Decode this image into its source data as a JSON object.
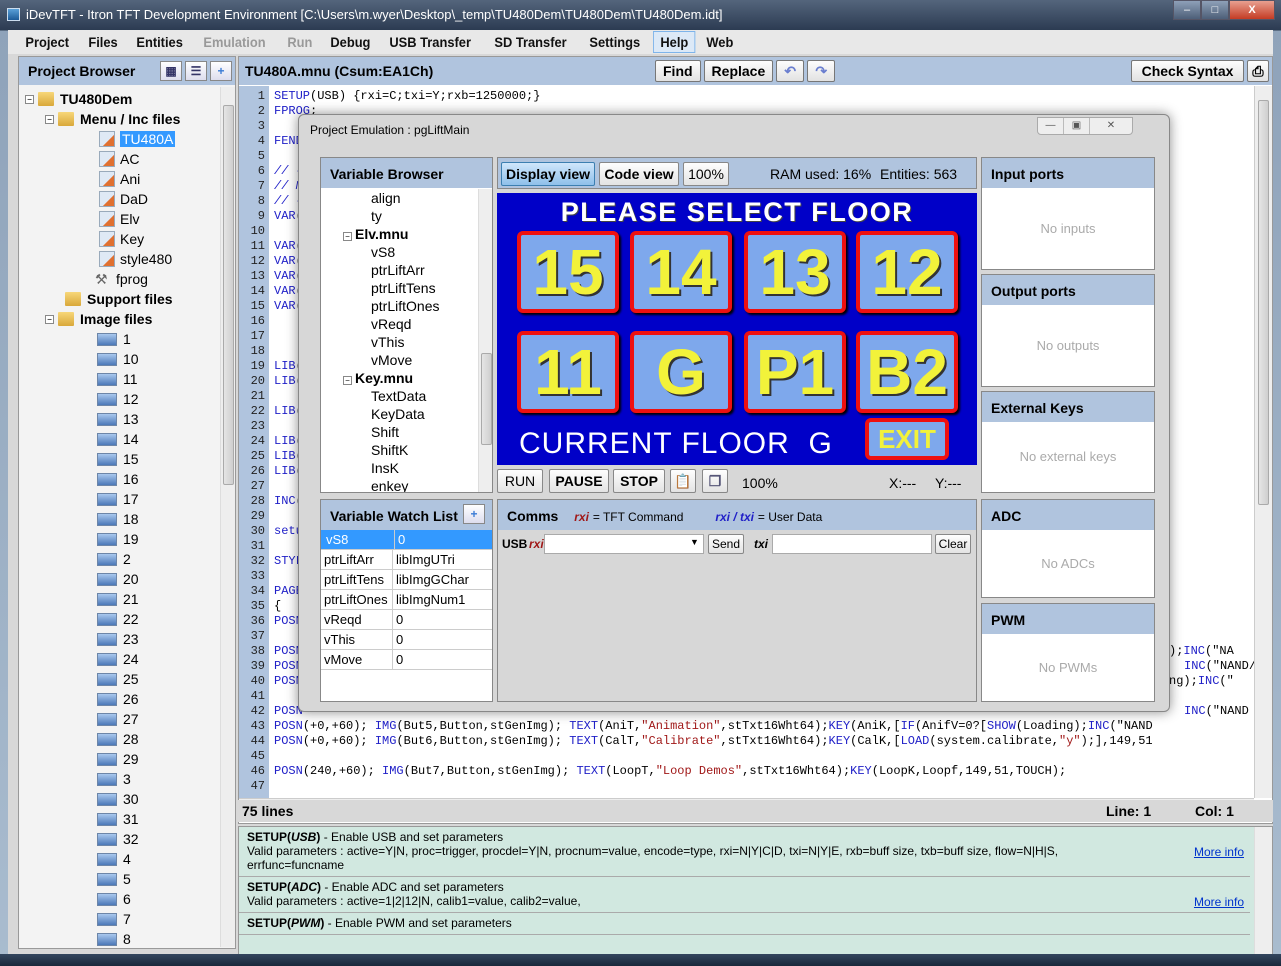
{
  "window": {
    "title": "iDevTFT - Itron TFT Development Environment  [C:\\Users\\m.wyer\\Desktop\\_temp\\TU480Dem\\TU480Dem\\TU480Dem.idt]",
    "minimize": "–",
    "maximize": "□",
    "close": "X"
  },
  "menu": [
    {
      "label": "Project",
      "state": "normal"
    },
    {
      "label": "Files",
      "state": "normal"
    },
    {
      "label": "Entities",
      "state": "normal"
    },
    {
      "label": "Emulation",
      "state": "disabled"
    },
    {
      "label": "Run",
      "state": "disabled"
    },
    {
      "label": "Debug",
      "state": "normal"
    },
    {
      "label": "USB Transfer",
      "state": "normal"
    },
    {
      "label": "SD Transfer",
      "state": "normal"
    },
    {
      "label": "Settings",
      "state": "normal"
    },
    {
      "label": "Help",
      "state": "active"
    },
    {
      "label": "Web",
      "state": "normal"
    }
  ],
  "project_browser": {
    "title": "Project Browser",
    "root": "TU480Dem",
    "menu_folder": "Menu / Inc files",
    "menu_files": [
      "TU480A",
      "AC",
      "Ani",
      "DaD",
      "Elv",
      "Key",
      "style480"
    ],
    "selected_file": "TU480A",
    "tool_file": "fprog",
    "support_folder": "Support files",
    "image_folder": "Image files",
    "image_files": [
      "1",
      "10",
      "11",
      "12",
      "13",
      "14",
      "15",
      "16",
      "17",
      "18",
      "19",
      "2",
      "20",
      "21",
      "22",
      "23",
      "24",
      "25",
      "26",
      "27",
      "28",
      "29",
      "3",
      "30",
      "31",
      "32",
      "4",
      "5",
      "6",
      "7",
      "8"
    ]
  },
  "editor": {
    "file_title": "TU480A.mnu  (Csum:EA1Ch)",
    "find_label": "Find",
    "replace_label": "Replace",
    "check_syntax_label": "Check Syntax",
    "lines": [
      {
        "n": "1",
        "t": "SETUP(USB) {rxi=C;txi=Y;rxb=1250000;}"
      },
      {
        "n": "2",
        "t": "FPROG;"
      },
      {
        "n": "3",
        "t": ""
      },
      {
        "n": "4",
        "t": "FEND"
      },
      {
        "n": "5",
        "t": ""
      },
      {
        "n": "6",
        "t": "// -"
      },
      {
        "n": "7",
        "t": "// M"
      },
      {
        "n": "8",
        "t": "// -"
      },
      {
        "n": "9",
        "t": "VAR("
      },
      {
        "n": "10",
        "t": ""
      },
      {
        "n": "11",
        "t": "VAR("
      },
      {
        "n": "12",
        "t": "VAR("
      },
      {
        "n": "13",
        "t": "VAR("
      },
      {
        "n": "14",
        "t": "VAR("
      },
      {
        "n": "15",
        "t": "VAR("
      },
      {
        "n": "16",
        "t": ""
      },
      {
        "n": "17",
        "t": ""
      },
      {
        "n": "18",
        "t": ""
      },
      {
        "n": "19",
        "t": "LIB("
      },
      {
        "n": "20",
        "t": "LIB("
      },
      {
        "n": "21",
        "t": ""
      },
      {
        "n": "22",
        "t": "LIB("
      },
      {
        "n": "23",
        "t": ""
      },
      {
        "n": "24",
        "t": "LIB("
      },
      {
        "n": "25",
        "t": "LIB("
      },
      {
        "n": "26",
        "t": "LIB("
      },
      {
        "n": "27",
        "t": ""
      },
      {
        "n": "28",
        "t": "INC("
      },
      {
        "n": "29",
        "t": ""
      },
      {
        "n": "30",
        "t": "setu"
      },
      {
        "n": "31",
        "t": ""
      },
      {
        "n": "32",
        "t": "STYL"
      },
      {
        "n": "33",
        "t": ""
      },
      {
        "n": "34",
        "t": "PAGE"
      },
      {
        "n": "35",
        "t": "{"
      },
      {
        "n": "36",
        "t": "POSN"
      },
      {
        "n": "37",
        "t": ""
      },
      {
        "n": "38",
        "t": "POSN"
      },
      {
        "n": "39",
        "t": "POSN"
      },
      {
        "n": "40",
        "t": "POSN"
      },
      {
        "n": "41",
        "t": ""
      },
      {
        "n": "42",
        "t": "POSN"
      },
      {
        "n": "43",
        "t": "POSN(+0,+60); IMG(But5,Button,stGenImg); TEXT(AniT,\"Animation\",stTxt16Wht64);KEY(AniK,[IF(AnifV=0?[SHOW(Loading);INC(\"NAND"
      },
      {
        "n": "44",
        "t": "POSN(+0,+60); IMG(But6,Button,stGenImg); TEXT(CalT,\"Calibrate\",stTxt16Wht64);KEY(CalK,[LOAD(system.calibrate,\"y\");],149,51"
      },
      {
        "n": "45",
        "t": ""
      },
      {
        "n": "46",
        "t": "POSN(240,+60); IMG(But7,Button,stGenImg); TEXT(LoopT,\"Loop Demos\",stTxt16Wht64);KEY(LoopK,Loopf,149,51,TOUCH);"
      },
      {
        "n": "47",
        "t": ""
      }
    ],
    "right_fragments": [
      {
        "line": "38",
        "t": ");INC(\"NA"
      },
      {
        "line": "39",
        "t": "INC(\"NAND/"
      },
      {
        "line": "40",
        "t": "ng);INC(\""
      },
      {
        "line": "42",
        "t": "INC(\"NAND"
      }
    ],
    "status": {
      "lines": "75 lines",
      "line": "Line: 1",
      "col": "Col: 1"
    }
  },
  "help": [
    {
      "cmd": "SETUP(",
      "arg": "USB",
      "desc": ") - Enable USB and set parameters",
      "params": "Valid parameters : active=Y|N, proc=trigger, procdel=Y|N, procnum=value, encode=type, rxi=N|Y|C|D, txi=N|Y|E, rxb=buff size, txb=buff size, flow=N|H|S, errfunc=funcname",
      "more": "More info"
    },
    {
      "cmd": "SETUP(",
      "arg": "ADC",
      "desc": ") - Enable ADC and set parameters",
      "params": "Valid parameters : active=1|2|12|N, calib1=value, calib2=value,",
      "more": "More info"
    },
    {
      "cmd": "SETUP(",
      "arg": "PWM",
      "desc": ") - Enable PWM and set parameters",
      "params": "",
      "more": ""
    }
  ],
  "emulation": {
    "title": "Project Emulation : pgLiftMain",
    "variable_browser": {
      "title": "Variable Browser",
      "items": [
        {
          "label": "align",
          "bold": false,
          "level": 2
        },
        {
          "label": "ty",
          "bold": false,
          "level": 2
        },
        {
          "label": "Elv.mnu",
          "bold": true,
          "level": 1
        },
        {
          "label": "vS8",
          "bold": false,
          "level": 2
        },
        {
          "label": "ptrLiftArr",
          "bold": false,
          "level": 2
        },
        {
          "label": "ptrLiftTens",
          "bold": false,
          "level": 2
        },
        {
          "label": "ptrLiftOnes",
          "bold": false,
          "level": 2
        },
        {
          "label": "vReqd",
          "bold": false,
          "level": 2
        },
        {
          "label": "vThis",
          "bold": false,
          "level": 2
        },
        {
          "label": "vMove",
          "bold": false,
          "level": 2
        },
        {
          "label": "Key.mnu",
          "bold": true,
          "level": 1
        },
        {
          "label": "TextData",
          "bold": false,
          "level": 2
        },
        {
          "label": "KeyData",
          "bold": false,
          "level": 2
        },
        {
          "label": "Shift",
          "bold": false,
          "level": 2
        },
        {
          "label": "ShiftK",
          "bold": false,
          "level": 2
        },
        {
          "label": "InsK",
          "bold": false,
          "level": 2
        },
        {
          "label": "enkey",
          "bold": false,
          "level": 2
        }
      ]
    },
    "watch_list": {
      "title": "Variable Watch List",
      "rows": [
        {
          "name": "vS8",
          "value": "0",
          "selected": true
        },
        {
          "name": "ptrLiftArr",
          "value": "libImgUTri",
          "selected": false
        },
        {
          "name": "ptrLiftTens",
          "value": "libImgGChar",
          "selected": false
        },
        {
          "name": "ptrLiftOnes",
          "value": "libImgNum1",
          "selected": false
        },
        {
          "name": "vReqd",
          "value": "0",
          "selected": false
        },
        {
          "name": "vThis",
          "value": "0",
          "selected": false
        },
        {
          "name": "vMove",
          "value": "0",
          "selected": false
        }
      ]
    },
    "view_tabs": {
      "display": "Display view",
      "code": "Code view",
      "zoom": "100%"
    },
    "ram_used": "RAM used: 16%",
    "entities": "Entities: 563",
    "tft": {
      "title": "PLEASE SELECT FLOOR",
      "floors": [
        "15",
        "14",
        "13",
        "12",
        "11",
        "G",
        "P1",
        "B2"
      ],
      "current_floor_label": "CURRENT FLOOR",
      "current_floor": "G",
      "exit": "EXIT",
      "colors": {
        "bg": "#0000c8",
        "button": "#7ea8ec",
        "border": "#ee1010",
        "text": "#f2f23a"
      }
    },
    "controls": {
      "run": "RUN",
      "pause": "PAUSE",
      "stop": "STOP",
      "zoom": "100%",
      "x": "X:---",
      "y": "Y:---"
    },
    "comms": {
      "title": "Comms",
      "legend_rxi": "rxi",
      "legend_rxi_text": "= TFT Command",
      "legend_user": "rxi / txi",
      "legend_user_text": "= User Data",
      "usb_label": "USB",
      "rxi_label": "rxi",
      "rxi_value": "",
      "send": "Send",
      "txi_label": "txi",
      "txi_value": "",
      "clear": "Clear"
    },
    "side_panels": [
      {
        "title": "Input ports",
        "empty": "No inputs"
      },
      {
        "title": "Output ports",
        "empty": "No outputs"
      },
      {
        "title": "External Keys",
        "empty": "No external keys"
      },
      {
        "title": "ADC",
        "empty": "No ADCs"
      },
      {
        "title": "PWM",
        "empty": "No PWMs"
      }
    ]
  }
}
